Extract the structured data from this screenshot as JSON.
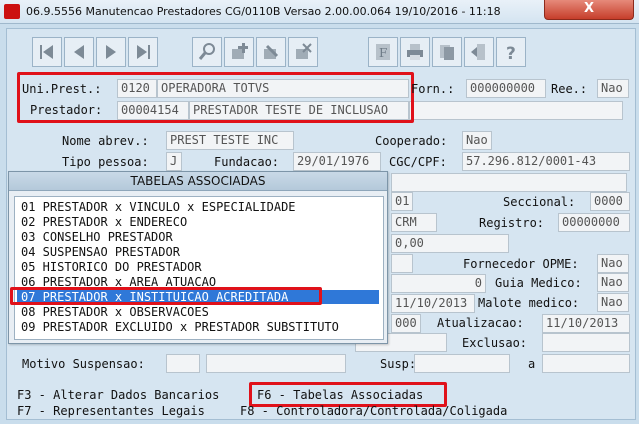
{
  "window": {
    "title": "06.9.5556 Manutencao  Prestadores CG/0110B Versao 2.00.00.064 19/10/2016 - 11:18",
    "close_label": "X"
  },
  "toolbar": {
    "icons": [
      "first-icon",
      "prev-icon",
      "next-icon",
      "last-icon",
      "search-icon",
      "add-icon",
      "edit-icon",
      "delete-icon",
      "f-icon",
      "print-icon",
      "copy-icon",
      "exit-icon",
      "help-icon"
    ]
  },
  "header": {
    "uni_prest_label": "Uni.Prest.:",
    "uni_prest_code": "0120",
    "uni_prest_name": "OPERADORA TOTVS",
    "prestador_label": "Prestador:",
    "prestador_code": "00004154",
    "prestador_name": "PRESTADOR TESTE DE INCLUSAO",
    "forn_label": "Forn.:",
    "forn_value": "000000000",
    "ree_label": "Ree.:",
    "ree_value": "Nao"
  },
  "form": {
    "nome_abrev_label": "Nome abrev.:",
    "nome_abrev_value": "PREST TESTE INC",
    "cooperado_label": "Cooperado:",
    "cooperado_value": "Nao",
    "tipo_pessoa_label": "Tipo pessoa:",
    "tipo_pessoa_value": "J",
    "fundacao_label": "Fundacao:",
    "fundacao_value": "29/01/1976",
    "cgc_label": "CGC/CPF:",
    "cgc_value": "57.296.812/0001-43",
    "field_01": "01",
    "seccional_label": "Seccional:",
    "seccional_value": "0000",
    "crm_value": "CRM",
    "registro_label": "Registro:",
    "registro_value": "00000000",
    "valor": "0,00",
    "fornecedor_opme_label": "Fornecedor OPME:",
    "fornecedor_opme_value": "Nao",
    "zero_value": "0",
    "guia_medico_label": "Guia Medico:",
    "guia_medico_value": "Nao",
    "date_value": "11/10/2013",
    "malote_label": "Malote medico:",
    "malote_value": "Nao",
    "code_000": "000",
    "atualizacao_label": "Atualizacao:",
    "atualizacao_value": "11/10/2013",
    "exclusao_label": "Exclusao:",
    "motivo_label": "Motivo Suspensao:",
    "susp_label": "Susp:",
    "a_label": "a"
  },
  "dialog": {
    "title": "TABELAS ASSOCIADAS",
    "items": [
      "01 PRESTADOR x VINCULO x ESPECIALIDADE",
      "02 PRESTADOR x ENDERECO",
      "03 CONSELHO PRESTADOR",
      "04 SUSPENSAO PRESTADOR",
      "05 HISTORICO DO PRESTADOR",
      "06 PRESTADOR x AREA ATUACAO",
      "07 PRESTADOR x INSTITUICAO ACREDITADA",
      "08 PRESTADOR x OBSERVACOES",
      "09 PRESTADOR EXCLUIDO x PRESTADOR SUBSTITUTO"
    ],
    "selected_index": 6
  },
  "footer": {
    "f3": "F3 - Alterar Dados Bancarios",
    "f6": "F6 - Tabelas Associadas",
    "f7": "F7 - Representantes Legais",
    "f8": "F8 - Controladora/Controlada/Coligada"
  },
  "colors": {
    "highlight": "#e0111a",
    "selection": "#2f78d8",
    "background": "#c9ddec"
  }
}
